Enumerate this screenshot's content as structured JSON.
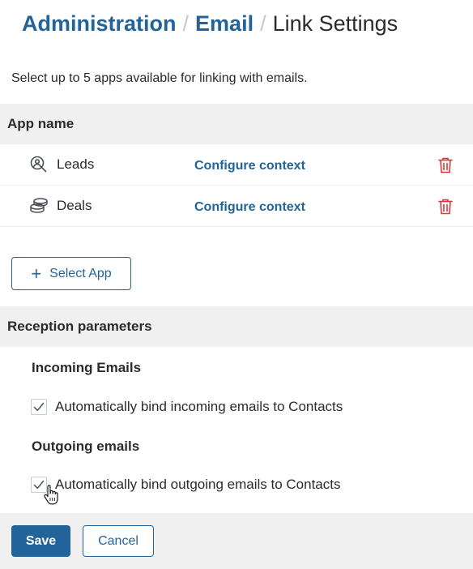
{
  "breadcrumb": {
    "items": [
      "Administration",
      "Email"
    ],
    "separator": "/",
    "current": "Link Settings"
  },
  "description": "Select up to 5 apps available for linking with emails.",
  "apps_section": {
    "header": "App name",
    "rows": [
      {
        "icon": "user-search-icon",
        "name": "Leads",
        "configure_label": "Configure context",
        "delete_icon": "trash-icon"
      },
      {
        "icon": "coins-stack-icon",
        "name": "Deals",
        "configure_label": "Configure context",
        "delete_icon": "trash-icon"
      }
    ],
    "select_app_label": "Select App",
    "select_app_icon": "plus-icon"
  },
  "reception": {
    "header": "Reception parameters",
    "incoming": {
      "title": "Incoming Emails",
      "checkbox_label": "Automatically bind incoming emails to Contacts",
      "checked": true
    },
    "outgoing": {
      "title": "Outgoing emails",
      "checkbox_label": "Automatically bind outgoing emails to Contacts",
      "checked": true
    }
  },
  "footer": {
    "save_label": "Save",
    "cancel_label": "Cancel"
  },
  "colors": {
    "accent": "#22649a",
    "danger": "#d9363e",
    "section_bg": "#f0f0f0",
    "text": "#2b2b2b"
  }
}
